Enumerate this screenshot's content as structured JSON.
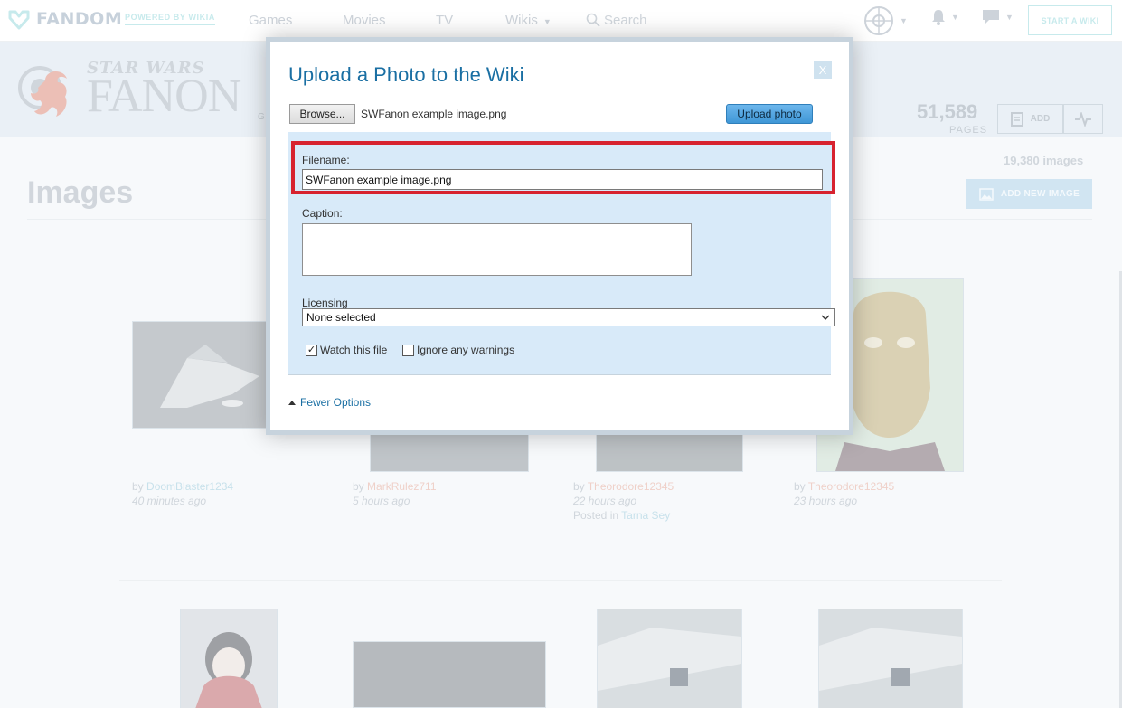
{
  "topnav": {
    "brand": "FANDOM",
    "powered_by": "POWERED BY WIKIA",
    "links": [
      "Games",
      "Movies",
      "TV",
      "Wikis"
    ],
    "search_placeholder": "Search",
    "start_wiki": "START A WIKI"
  },
  "community": {
    "wordmark_top": "STAR WARS",
    "wordmark_main": "FANON",
    "gl_fragment": "G",
    "pages_count": "51,589",
    "pages_label": "PAGES",
    "add_label": "ADD"
  },
  "page": {
    "title": "Images",
    "images_count": "19,380 images",
    "add_new_image": "ADD NEW IMAGE",
    "items": [
      {
        "by": "by",
        "user": "DoomBlaster1234",
        "time": "40 minutes ago"
      },
      {
        "by": "by",
        "user": "MarkRulez711",
        "time": "5 hours ago"
      },
      {
        "by": "by",
        "user": "Theorodore12345",
        "time": "22 hours ago",
        "posted_in": "Posted in",
        "posted_page": "Tarna Sey"
      },
      {
        "by": "by",
        "user": "Theorodore12345",
        "time": "23 hours ago"
      }
    ]
  },
  "modal": {
    "title": "Upload a Photo to the Wiki",
    "close": "X",
    "browse_label": "Browse...",
    "chosen_file": "SWFanon example image.png",
    "upload_label": "Upload photo",
    "filename_label": "Filename:",
    "filename_value": "SWFanon example image.png",
    "caption_label": "Caption:",
    "caption_value": "",
    "licensing_label": "Licensing",
    "licensing_value": "None selected",
    "watch_label": "Watch this file",
    "watch_checked": true,
    "ignore_label": "Ignore any warnings",
    "ignore_checked": false,
    "fewer_options": "Fewer Options"
  },
  "colors": {
    "modal_title": "#1a6fa3",
    "options_panel": "#d8eaf9",
    "highlight": "#d7222f",
    "upload_button": "#4ea3e0"
  }
}
